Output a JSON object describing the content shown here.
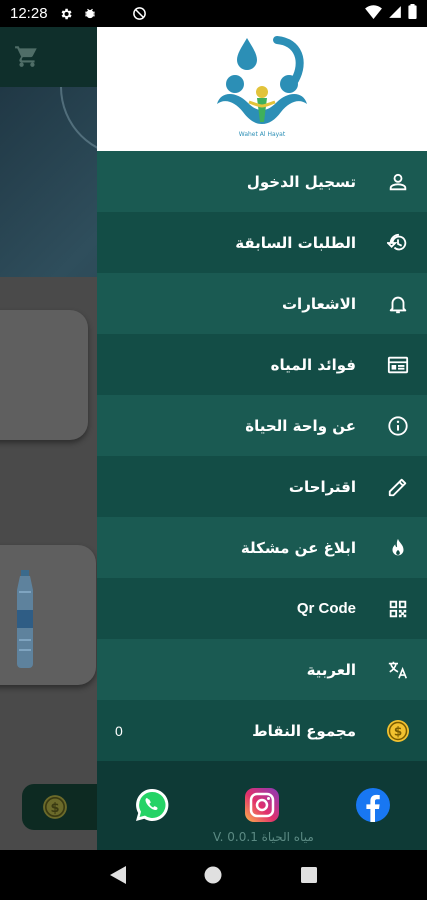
{
  "status_bar": {
    "time": "12:28",
    "icons": [
      "gear-icon",
      "bug-icon",
      "no-disturb-icon",
      "wifi-icon",
      "signal-icon",
      "battery-icon"
    ]
  },
  "drawer": {
    "logo": {
      "name": "app-logo"
    },
    "menu": [
      {
        "label": "تسجيل الدخول",
        "icon": "person-icon"
      },
      {
        "label": "الطلبات السابقة",
        "icon": "history-icon"
      },
      {
        "label": "الاشعارات",
        "icon": "bell-icon"
      },
      {
        "label": "فوائد المياه",
        "icon": "article-icon"
      },
      {
        "label": "عن واحة الحياة",
        "icon": "info-icon"
      },
      {
        "label": "اقتراحات",
        "icon": "pencil-icon"
      },
      {
        "label": "ابلاغ عن مشكلة",
        "icon": "fire-icon"
      },
      {
        "label": "Qr Code",
        "icon": "qr-icon"
      },
      {
        "label": "العربية",
        "icon": "translate-icon"
      },
      {
        "label": "مجموع النقاط",
        "icon": "coin-icon",
        "value": "0"
      }
    ],
    "social": [
      "whatsapp-icon",
      "instagram-icon",
      "facebook-icon"
    ],
    "version": "V. 0.0.1  مياه الحياة"
  },
  "colors": {
    "drawer_bg": "#0e3a36",
    "row_light": "#1a5a52",
    "row_dark": "#134d46",
    "coin_yellow": "#f2c230"
  }
}
